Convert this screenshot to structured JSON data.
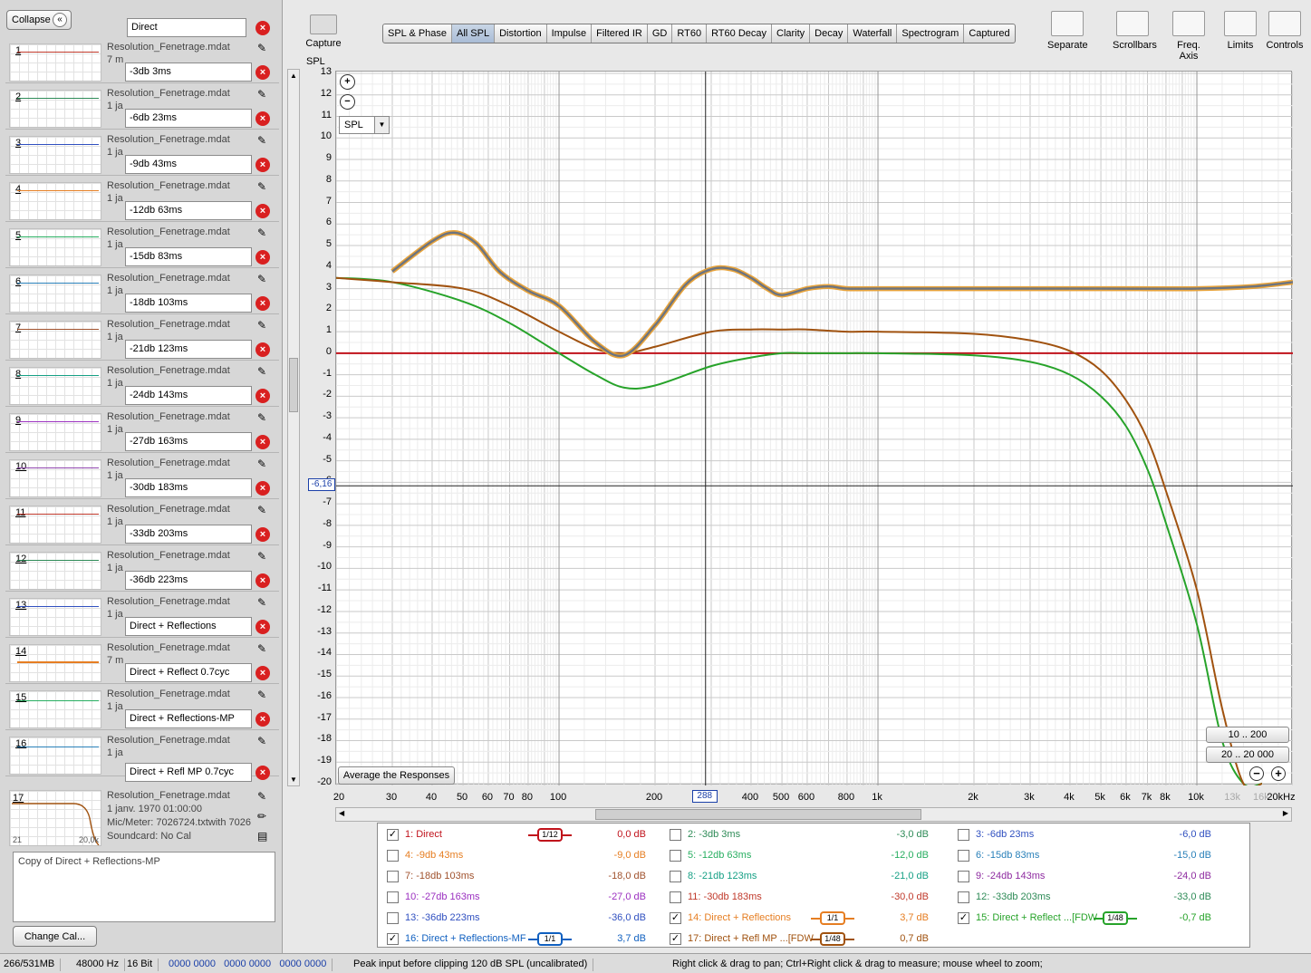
{
  "left_panel": {
    "collapse_label": "Collapse",
    "measurements": [
      {
        "num": "1",
        "color": "#c0392b",
        "file": "Resolution_Fenetrage.mdat",
        "sub": "7 m",
        "name": "Direct"
      },
      {
        "num": "2",
        "color": "#2e8b57",
        "file": "Resolution_Fenetrage.mdat",
        "sub": "1 ja",
        "name": "-3db 3ms"
      },
      {
        "num": "3",
        "color": "#3050c0",
        "file": "Resolution_Fenetrage.mdat",
        "sub": "1 ja",
        "name": "-6db 23ms"
      },
      {
        "num": "4",
        "color": "#e67e22",
        "file": "Resolution_Fenetrage.mdat",
        "sub": "1 ja",
        "name": "-9db 43ms"
      },
      {
        "num": "5",
        "color": "#27ae60",
        "file": "Resolution_Fenetrage.mdat",
        "sub": "1 ja",
        "name": "-12db 63ms"
      },
      {
        "num": "6",
        "color": "#2980b9",
        "file": "Resolution_Fenetrage.mdat",
        "sub": "1 ja",
        "name": "-15db 83ms"
      },
      {
        "num": "7",
        "color": "#a0522d",
        "file": "Resolution_Fenetrage.mdat",
        "sub": "1 ja",
        "name": "-18db 103ms"
      },
      {
        "num": "8",
        "color": "#16a085",
        "file": "Resolution_Fenetrage.mdat",
        "sub": "1 ja",
        "name": "-21db 123ms"
      },
      {
        "num": "9",
        "color": "#9b30c0",
        "file": "Resolution_Fenetrage.mdat",
        "sub": "1 ja",
        "name": "-24db 143ms"
      },
      {
        "num": "10",
        "color": "#8e44ad",
        "file": "Resolution_Fenetrage.mdat",
        "sub": "1 ja",
        "name": "-27db 163ms"
      },
      {
        "num": "11",
        "color": "#c0392b",
        "file": "Resolution_Fenetrage.mdat",
        "sub": "1 ja",
        "name": "-30db 183ms"
      },
      {
        "num": "12",
        "color": "#2e8b57",
        "file": "Resolution_Fenetrage.mdat",
        "sub": "1 ja",
        "name": "-33db 203ms"
      },
      {
        "num": "13",
        "color": "#3050c0",
        "file": "Resolution_Fenetrage.mdat",
        "sub": "1 ja",
        "name": "-36db 223ms"
      },
      {
        "num": "14",
        "color": "#e67e22",
        "file": "Resolution_Fenetrage.mdat",
        "sub": "7 m",
        "name": "Direct + Reflections"
      },
      {
        "num": "15",
        "color": "#27ae60",
        "file": "Resolution_Fenetrage.mdat",
        "sub": "1 ja",
        "name": "Direct + Reflect 0.7cyc"
      },
      {
        "num": "16",
        "color": "#2980b9",
        "file": "Resolution_Fenetrage.mdat",
        "sub": "1 ja",
        "name": "Direct + Reflections-MP"
      }
    ],
    "m16_name": "Direct + Refl MP 0.7cyc",
    "m17": {
      "num": "17",
      "file": "Resolution_Fenetrage.mdat",
      "date": "1 janv. 1970 01:00:00",
      "mic": "Mic/Meter: 7026724.txtwith 7026",
      "sound": "Soundcard: No Cal",
      "x_lo": "21",
      "x_hi": "20,0k"
    },
    "notes": "Copy of Direct + Reflections-MP",
    "change_cal": "Change Cal..."
  },
  "toolbar": {
    "capture": "Capture",
    "tabs": [
      "SPL & Phase",
      "All SPL",
      "Distortion",
      "Impulse",
      "Filtered IR",
      "GD",
      "RT60",
      "RT60 Decay",
      "Clarity",
      "Decay",
      "Waterfall",
      "Spectrogram",
      "Captured"
    ],
    "active_tab": "All SPL",
    "right_icons": [
      "Separate",
      "Scrollbars",
      "Freq. Axis",
      "Limits",
      "Controls"
    ]
  },
  "graph": {
    "ylabel": "SPL",
    "y_ticks": [
      "13",
      "12",
      "11",
      "10",
      "9",
      "8",
      "7",
      "6",
      "5",
      "4",
      "3",
      "2",
      "1",
      "0",
      "-1",
      "-2",
      "-3",
      "-4",
      "-5",
      "-6",
      "-7",
      "-8",
      "-9",
      "-10",
      "-11",
      "-12",
      "-13",
      "-14",
      "-15",
      "-16",
      "-17",
      "-18",
      "-19",
      "-20"
    ],
    "x_ticks": [
      "20",
      "30",
      "40",
      "50",
      "60",
      "70",
      "80",
      "100",
      "200",
      "400",
      "500",
      "600",
      "800",
      "1k",
      "2k",
      "3k",
      "4k",
      "5k",
      "6k",
      "7k",
      "8k",
      "10k",
      "13k",
      "16k",
      "20kHz"
    ],
    "x_tick_colors_dim": [
      "13k",
      "16k"
    ],
    "cursor_y": "-6,16",
    "cursor_x": "288",
    "spl_select": "SPL",
    "avg_button": "Average the Responses",
    "range1": "10 .. 200",
    "range2": "20 .. 20 000"
  },
  "chart_data": {
    "type": "line",
    "xlabel": "",
    "ylabel": "SPL",
    "x_scale": "log",
    "xlim": [
      20,
      20000
    ],
    "ylim": [
      -20,
      13
    ],
    "grid": true,
    "series": [
      {
        "name": "1: Direct",
        "color": "#c0121b",
        "x": [
          20,
          20000
        ],
        "y": [
          0,
          0
        ]
      },
      {
        "name": "16: Direct + Reflections-MF",
        "color": "#1060c0",
        "x": [
          30,
          40,
          47,
          55,
          65,
          80,
          100,
          130,
          160,
          200,
          250,
          300,
          350,
          400,
          450,
          500,
          600,
          700,
          800,
          1000,
          2000,
          5000,
          10000,
          15000,
          20000
        ],
        "y": [
          3.8,
          5.2,
          5.6,
          5.1,
          3.8,
          2.9,
          2.2,
          0.5,
          -0.1,
          1.3,
          3.2,
          3.9,
          3.9,
          3.5,
          3.0,
          2.7,
          3.0,
          3.1,
          3.0,
          3.0,
          3.0,
          3.0,
          3.0,
          3.1,
          3.3
        ]
      },
      {
        "name": "14: Direct + Reflections",
        "color": "#e8a33a",
        "x": [
          30,
          40,
          47,
          55,
          65,
          80,
          100,
          130,
          160,
          200,
          250,
          300,
          350,
          400,
          450,
          500,
          600,
          700,
          800,
          1000,
          2000,
          5000,
          10000,
          15000,
          20000
        ],
        "y": [
          3.8,
          5.2,
          5.6,
          5.1,
          3.8,
          2.9,
          2.2,
          0.5,
          -0.1,
          1.3,
          3.2,
          3.9,
          3.9,
          3.5,
          3.0,
          2.7,
          3.0,
          3.1,
          3.0,
          3.0,
          3.0,
          3.0,
          3.0,
          3.1,
          3.3
        ]
      },
      {
        "name": "17: Direct + Refl MP ...[FDW",
        "color": "#a0520f",
        "x": [
          20,
          30,
          50,
          70,
          100,
          130,
          160,
          200,
          300,
          400,
          500,
          600,
          800,
          1000,
          2000,
          3000,
          4000,
          5000,
          6000,
          7000,
          8000,
          10000,
          12000,
          14000,
          16000
        ],
        "y": [
          3.5,
          3.3,
          3.0,
          2.2,
          1.0,
          0.2,
          0.0,
          0.3,
          1.0,
          1.1,
          1.1,
          1.1,
          1.0,
          1.0,
          0.9,
          0.6,
          0.1,
          -0.8,
          -2.2,
          -4.0,
          -6.4,
          -11.0,
          -16.5,
          -20.0,
          -20.0
        ]
      },
      {
        "name": "15: Direct + Reflect ...[FDW",
        "color": "#27a32a",
        "x": [
          20,
          30,
          50,
          70,
          100,
          130,
          160,
          200,
          300,
          400,
          500,
          600,
          800,
          1000,
          2000,
          3000,
          4000,
          5000,
          6000,
          7000,
          8000,
          10000,
          12000,
          14000,
          16000
        ],
        "y": [
          3.5,
          3.3,
          2.4,
          1.4,
          0.0,
          -1.0,
          -1.6,
          -1.5,
          -0.6,
          -0.2,
          0.0,
          0.0,
          0.0,
          0.0,
          -0.1,
          -0.4,
          -1.0,
          -2.0,
          -3.4,
          -5.4,
          -7.9,
          -12.6,
          -18.0,
          -20.0,
          -20.0
        ]
      }
    ]
  },
  "legend": [
    {
      "checked": true,
      "name": "1: Direct",
      "color": "#c0121b",
      "value": "0,0 dB",
      "smooth": "1/12",
      "col": 0,
      "row": 0
    },
    {
      "checked": false,
      "name": "2: -3db 3ms",
      "color": "#2e8b57",
      "value": "-3,0 dB",
      "col": 1,
      "row": 0
    },
    {
      "checked": false,
      "name": "3: -6db 23ms",
      "color": "#3050c0",
      "value": "-6,0 dB",
      "col": 2,
      "row": 0
    },
    {
      "checked": false,
      "name": "4: -9db 43ms",
      "color": "#e67e22",
      "value": "-9,0 dB",
      "col": 0,
      "row": 1
    },
    {
      "checked": false,
      "name": "5: -12db 63ms",
      "color": "#27ae60",
      "value": "-12,0 dB",
      "col": 1,
      "row": 1
    },
    {
      "checked": false,
      "name": "6: -15db 83ms",
      "color": "#2980b9",
      "value": "-15,0 dB",
      "col": 2,
      "row": 1
    },
    {
      "checked": false,
      "name": "7: -18db 103ms",
      "color": "#a0522d",
      "value": "-18,0 dB",
      "col": 0,
      "row": 2
    },
    {
      "checked": false,
      "name": "8: -21db 123ms",
      "color": "#16a085",
      "value": "-21,0 dB",
      "col": 1,
      "row": 2
    },
    {
      "checked": false,
      "name": "9: -24db 143ms",
      "color": "#8e2ba0",
      "value": "-24,0 dB",
      "col": 2,
      "row": 2
    },
    {
      "checked": false,
      "name": "10: -27db 163ms",
      "color": "#9b30c0",
      "value": "-27,0 dB",
      "col": 0,
      "row": 3
    },
    {
      "checked": false,
      "name": "11: -30db 183ms",
      "color": "#c0392b",
      "value": "-30,0 dB",
      "col": 1,
      "row": 3
    },
    {
      "checked": false,
      "name": "12: -33db 203ms",
      "color": "#2e8b57",
      "value": "-33,0 dB",
      "col": 2,
      "row": 3
    },
    {
      "checked": false,
      "name": "13: -36db 223ms",
      "color": "#3050c0",
      "value": "-36,0 dB",
      "col": 0,
      "row": 4
    },
    {
      "checked": true,
      "name": "14: Direct + Reflections",
      "color": "#e67e22",
      "value": "3,7 dB",
      "smooth": "1/1",
      "col": 1,
      "row": 4
    },
    {
      "checked": true,
      "name": "15: Direct + Reflect ...[FDW",
      "color": "#27a32a",
      "value": "-0,7 dB",
      "smooth": "1/48",
      "col": 2,
      "row": 4
    },
    {
      "checked": true,
      "name": "16: Direct + Reflections-MF",
      "color": "#1060c0",
      "value": "3,7 dB",
      "smooth": "1/1",
      "col": 0,
      "row": 5
    },
    {
      "checked": true,
      "name": "17: Direct + Refl MP ...[FDW",
      "color": "#a0520f",
      "value": "0,7 dB",
      "smooth": "1/48",
      "col": 1,
      "row": 5
    }
  ],
  "status": {
    "mem": "266/531MB",
    "rate": "48000 Hz",
    "bits": "16 Bit",
    "levels": "0000 0000   0000 0000   0000 0000",
    "peak": "Peak input before clipping 120 dB SPL (uncalibrated)",
    "hint": "Right click & drag to pan; Ctrl+Right click & drag to measure; mouse wheel to zoom;"
  }
}
